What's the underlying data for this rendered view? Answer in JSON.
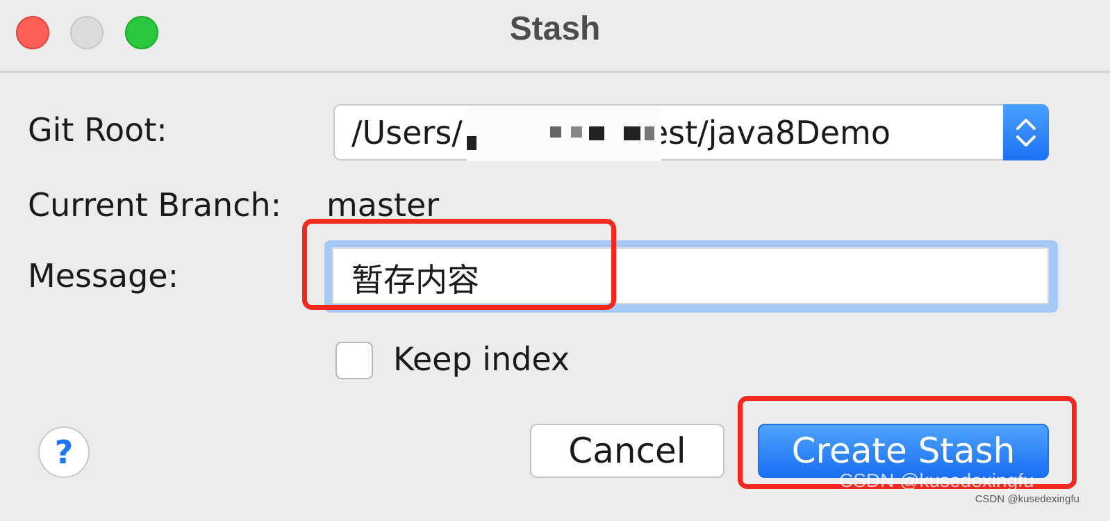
{
  "window": {
    "title": "Stash",
    "traffic_lights": [
      "close",
      "minimize",
      "zoom"
    ]
  },
  "form": {
    "git_root_label": "Git Root:",
    "git_root_value": "/Users/",
    "git_root_value_tail": "test/java8Demo",
    "current_branch_label": "Current Branch:",
    "current_branch_value": "master",
    "message_label": "Message:",
    "message_value": "暂存内容",
    "keep_index_label": "Keep index",
    "keep_index_checked": false
  },
  "buttons": {
    "help": "?",
    "cancel": "Cancel",
    "create": "Create Stash"
  },
  "watermark": {
    "large": "CSDN @kusedexingfu",
    "small": "CSDN @kusedexingfu"
  },
  "colors": {
    "accent": "#1a6ff2",
    "highlight": "#f2281c"
  }
}
